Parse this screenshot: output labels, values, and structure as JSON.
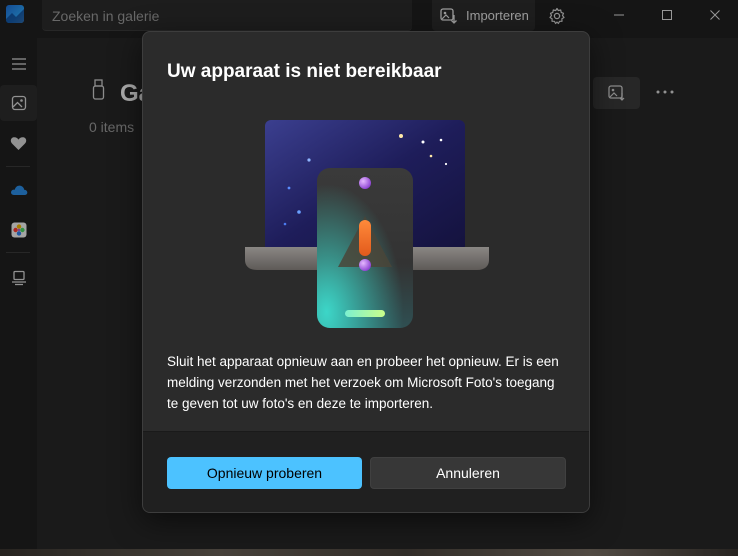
{
  "app": {
    "icon": "photos-app-icon",
    "search_placeholder": "Zoeken in galerie",
    "import_label": "Importeren"
  },
  "sidebar": {
    "items": [
      {
        "icon": "hamburger-menu-icon"
      },
      {
        "icon": "gallery-icon",
        "active": true
      },
      {
        "icon": "heart-icon"
      },
      {
        "icon": "onedrive-cloud-icon"
      },
      {
        "icon": "icloud-photos-icon"
      },
      {
        "icon": "device-icon"
      }
    ]
  },
  "main": {
    "title": "Ga",
    "count": "0 items"
  },
  "dialog": {
    "title": "Uw apparaat is niet bereikbaar",
    "body": "Sluit het apparaat opnieuw aan en probeer het opnieuw. Er is een melding verzonden met het verzoek om Microsoft Foto's toegang te geven tot uw foto's en deze te importeren.",
    "primary_label": "Opnieuw proberen",
    "secondary_label": "Annuleren"
  },
  "colors": {
    "accent": "#4cc2ff",
    "dialog_bg": "#2b2b2b",
    "footer_bg": "#202020",
    "warning_orange": "#ff7a2e"
  }
}
